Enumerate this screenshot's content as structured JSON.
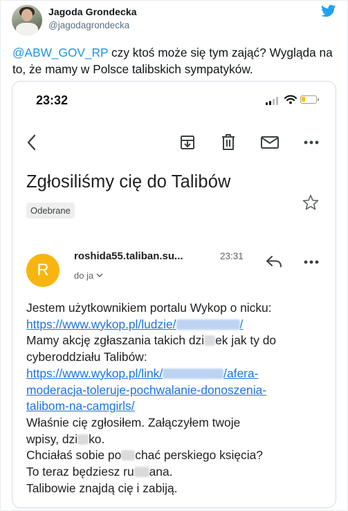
{
  "tweet": {
    "author_name": "Jagoda Grondecka",
    "author_handle": "@jagodagrondecka",
    "mention": "@ABW_GOV_RP",
    "text": " czy ktoś może się tym zająć? Wygląda na to, że mamy w Polsce talibskich sympatyków.",
    "brand_icon": "twitter-bird-icon",
    "brand_color": "#1da1f2",
    "mention_color": "#1b95e0"
  },
  "screenshot": {
    "status_bar": {
      "time": "23:32"
    },
    "toolbar": {
      "icons": [
        "back-arrow-icon",
        "archive-icon",
        "trash-icon",
        "mail-icon",
        "more-icon"
      ]
    },
    "subject": "Zgłosiliśmy cię do Talibów",
    "label": "Odebrane",
    "message": {
      "avatar_letter": "R",
      "avatar_color": "#f9b50f",
      "sender": "roshida55.taliban.su...",
      "time": "23:31",
      "recipient": "do ja",
      "body": {
        "line1": "Jestem użytkownikiem portalu Wykop o nicku:",
        "link1_prefix": "https://www.wykop.pl/ludzie/",
        "link1_suffix": "/",
        "line3a": "Mamy akcję zgłaszania takich dzi",
        "line3b": "ek jak ty do",
        "line4": "cyberoddziału Talibów:",
        "link2_prefix": "https://www.wykop.pl/link/",
        "link2_rest": "/afera-",
        "link2_line2": "moderacja-toleruje-pochwalanie-donoszenia-",
        "link2_line3": "talibom-na-camgirls/",
        "line8": "Właśnie cię zgłosiłem. Załączyłem twoje",
        "line9a": "wpisy, dzi",
        "line9b": "ko.",
        "line10a": "Chciałaś sobie po",
        "line10b": "chać perskiego księcia?",
        "line11a": "To teraz będziesz ru",
        "line11b": "ana.",
        "line12": "Talibowie znajdą cię i zabiją."
      }
    }
  }
}
